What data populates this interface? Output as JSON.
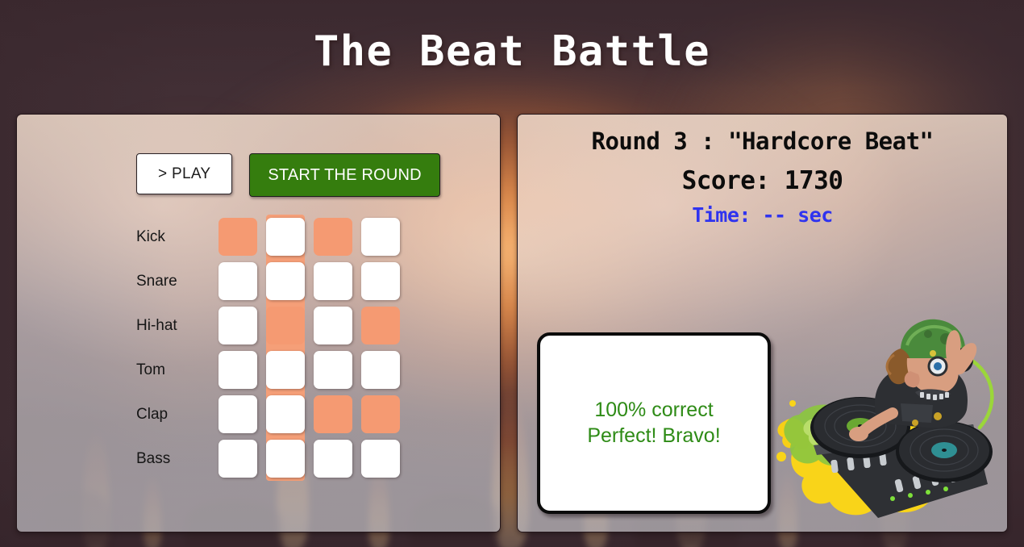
{
  "page": {
    "title": "The Beat Battle",
    "background_color": "#433036",
    "accent_orange": "#f59a72",
    "accent_green": "#357d0e",
    "accent_blue": "#2f33ef",
    "feedback_green": "#2e8b16"
  },
  "controls": {
    "play_label": "> PLAY",
    "start_round_label": "START THE ROUND"
  },
  "grid": {
    "active_column_index": 1,
    "columns": 4,
    "rows": [
      {
        "label": "Kick",
        "cells": [
          true,
          false,
          true,
          false
        ]
      },
      {
        "label": "Snare",
        "cells": [
          false,
          false,
          false,
          false
        ]
      },
      {
        "label": "Hi-hat",
        "cells": [
          false,
          true,
          false,
          true
        ]
      },
      {
        "label": "Tom",
        "cells": [
          false,
          false,
          false,
          false
        ]
      },
      {
        "label": "Clap",
        "cells": [
          false,
          false,
          true,
          true
        ]
      },
      {
        "label": "Bass",
        "cells": [
          false,
          false,
          false,
          false
        ]
      }
    ]
  },
  "round_info": {
    "round_title": "Round 3 : \"Hardcore Beat\"",
    "score_label": "Score: 1730",
    "time_label": "Time: -- sec"
  },
  "feedback": {
    "line1": "100% correct",
    "line2": "Perfect! Bravo!"
  },
  "illustration": {
    "name": "dj-character-turntables"
  }
}
